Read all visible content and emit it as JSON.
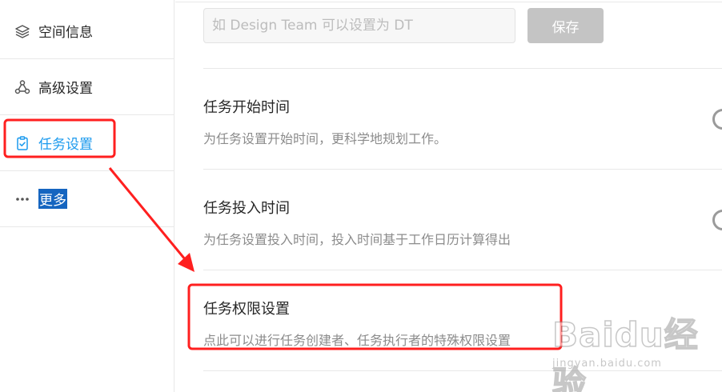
{
  "sidebar": {
    "items": [
      {
        "label": "空间信息",
        "icon": "layers-icon"
      },
      {
        "label": "高级设置",
        "icon": "nodes-icon"
      },
      {
        "label": "任务设置",
        "icon": "clipboard-icon",
        "active": true
      },
      {
        "label": "更多",
        "icon": "ellipsis-icon"
      }
    ]
  },
  "abbreviation": {
    "placeholder": "如 Design Team 可以设置为 DT",
    "save_label": "保存"
  },
  "settings": [
    {
      "title": "任务开始时间",
      "desc": "为任务设置开始时间，更科学地规划工作。"
    },
    {
      "title": "任务投入时间",
      "desc": "为任务设置投入时间，投入时间基于工作日历计算得出"
    },
    {
      "title": "任务权限设置",
      "desc": "点此可以进行任务创建者、任务执行者的特殊权限设置"
    }
  ],
  "watermark": {
    "logo": "Baidu经验",
    "url": "jingyan.baidu.com"
  },
  "colors": {
    "accent": "#1b9aee",
    "annotation": "#ff1f1f",
    "selection": "#1565c0",
    "button_disabled": "#c4c4c4"
  }
}
